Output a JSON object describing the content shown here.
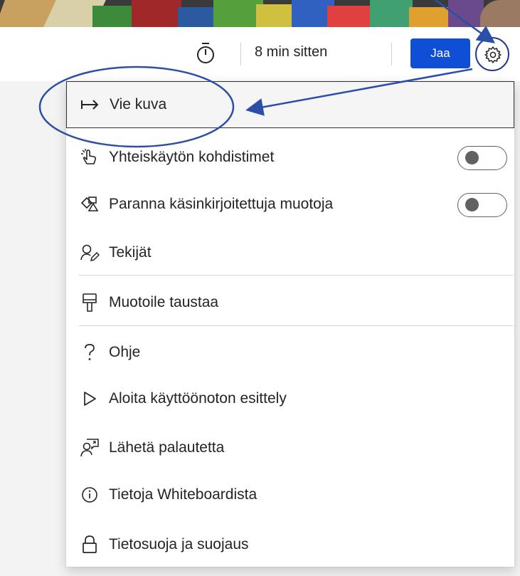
{
  "toolbar": {
    "timer_icon": "stopwatch-icon",
    "last_edited": "8 min sitten",
    "share_label": "Jaa",
    "settings_icon": "gear-icon",
    "accent_color": "#0f4fd6"
  },
  "menu": {
    "items": [
      {
        "label": "Vie kuva",
        "icon": "export-arrow-icon"
      },
      {
        "label": "Yhteiskäytön kohdistimet",
        "icon": "hand-pointer-icon",
        "toggle": false
      },
      {
        "label": "Paranna käsinkirjoitettuja muotoja",
        "icon": "shapes-icon",
        "toggle": false
      },
      {
        "label": "Tekijät",
        "icon": "people-edit-icon"
      },
      {
        "label": "Muotoile taustaa",
        "icon": "paint-brush-icon"
      },
      {
        "label": "Ohje",
        "icon": "question-mark-icon"
      },
      {
        "label": "Aloita käyttöönoton esittely",
        "icon": "play-icon"
      },
      {
        "label": "Lähetä palautetta",
        "icon": "feedback-icon"
      },
      {
        "label": "Tietoja Whiteboardista",
        "icon": "info-icon"
      },
      {
        "label": "Tietosuoja ja suojaus",
        "icon": "lock-icon"
      }
    ]
  },
  "annotation_color": "#2b4fa8"
}
